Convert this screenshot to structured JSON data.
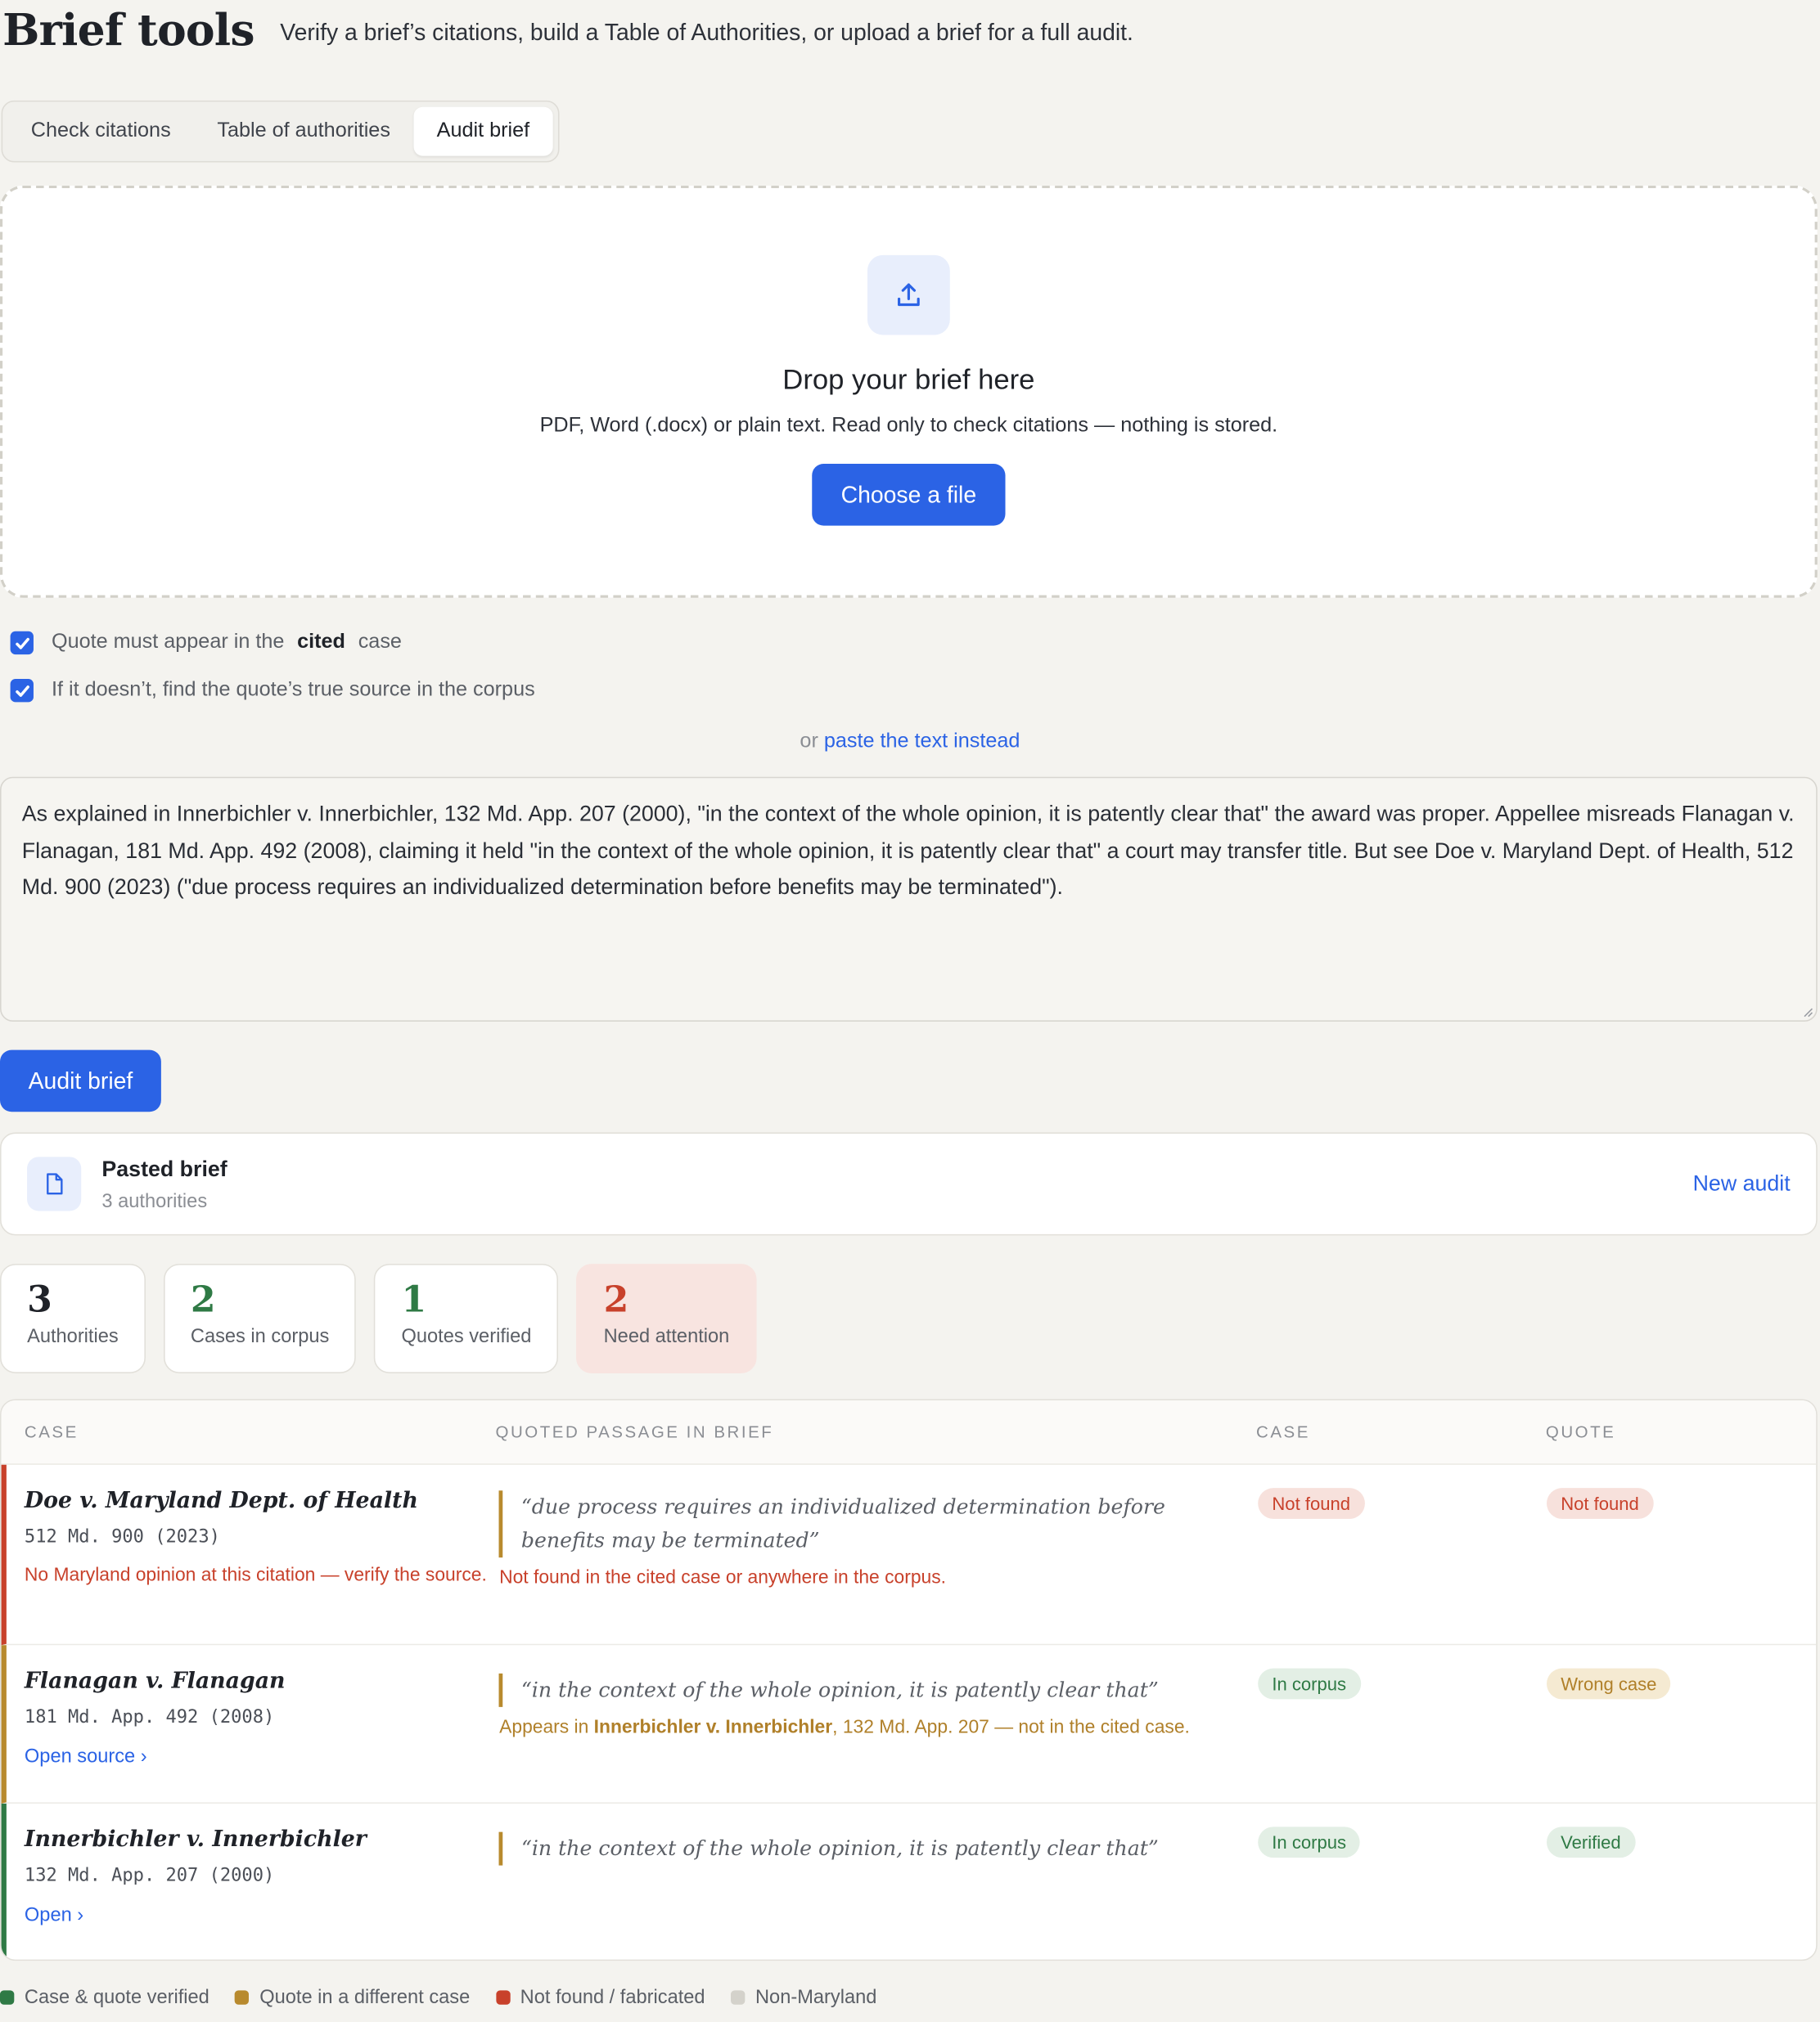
{
  "header": {
    "title": "Brief tools",
    "subtitle": "Verify a brief’s citations, build a Table of Authorities, or upload a brief for a full audit."
  },
  "tabs": [
    {
      "label": "Check citations",
      "active": false
    },
    {
      "label": "Table of authorities",
      "active": false
    },
    {
      "label": "Audit brief",
      "active": true
    }
  ],
  "dropzone": {
    "icon": "upload-icon",
    "title": "Drop your brief here",
    "description": "PDF, Word (.docx) or plain text. Read only to check citations — nothing is stored.",
    "button_label": "Choose a file"
  },
  "options": {
    "opt1_before": "Quote must appear in the",
    "opt1_bold": "cited",
    "opt1_after": "case",
    "opt1_checked": true,
    "opt2_label": "If it doesn’t, find the quote’s true source in the corpus",
    "opt2_checked": true
  },
  "paste": {
    "prefix": "or",
    "link": "paste the text instead"
  },
  "brief_text": "As explained in Innerbichler v. Innerbichler, 132 Md. App. 207 (2000), \"in the context of the whole opinion, it is patently clear that\" the award was proper. Appellee misreads Flanagan v. Flanagan, 181 Md. App. 492 (2008), claiming it held \"in the context of the whole opinion, it is patently clear that\" a court may transfer title. But see Doe v. Maryland Dept. of Health, 512 Md. 900 (2023) (\"due process requires an individualized determination before benefits may be terminated\").",
  "audit_button": "Audit brief",
  "brief_card": {
    "icon": "document-icon",
    "name": "Pasted brief",
    "count": "3 authorities",
    "new_audit": "New audit"
  },
  "stats": [
    {
      "value": "3",
      "label": "Authorities",
      "color": "#1f2228"
    },
    {
      "value": "2",
      "label": "Cases in corpus",
      "color": "#2f7a45"
    },
    {
      "value": "1",
      "label": "Quotes verified",
      "color": "#2f7a45"
    },
    {
      "value": "2",
      "label": "Need attention",
      "color": "#c8412b"
    }
  ],
  "table": {
    "headers": [
      "CASE",
      "QUOTED PASSAGE IN BRIEF",
      "CASE",
      "QUOTE"
    ],
    "rows": [
      {
        "case": "Doe v. Maryland Dept. of Health",
        "cite": "512 Md. 900 (2023)",
        "note": "No Maryland opinion at this citation — verify the source.",
        "quote": "“due process requires an individualized determination before benefits may be terminated”",
        "quote_note": "Not found in the cited case or anywhere in the corpus.",
        "case_status": "Not found",
        "quote_status": "Not found",
        "border_color": "#c8412b"
      },
      {
        "case": "Flanagan v. Flanagan",
        "cite": "181 Md. App. 492 (2008)",
        "link": "Open source ›",
        "quote": "“in the context of the whole opinion, it is patently clear that”",
        "quote_note_before": "Appears in",
        "quote_note_case": "Innerbichler v. Innerbichler",
        "quote_note_after": ", 132 Md. App. 207 — not in the cited case.",
        "case_status": "In corpus",
        "quote_status": "Wrong case",
        "border_color": "#b88a2e"
      },
      {
        "case": "Innerbichler v. Innerbichler",
        "cite": "132 Md. App. 207 (2000)",
        "link": "Open ›",
        "quote": "“in the context of the whole opinion, it is patently clear that”",
        "case_status": "In corpus",
        "quote_status": "Verified",
        "border_color": "#2f7a45"
      }
    ]
  },
  "legend": [
    {
      "label": "Case & quote verified",
      "color": "#2f7a45"
    },
    {
      "label": "Quote in a different case",
      "color": "#b88a2e"
    },
    {
      "label": "Not found / fabricated",
      "color": "#c8412b"
    },
    {
      "label": "Non-Maryland",
      "color": "#d4d2cb"
    }
  ]
}
